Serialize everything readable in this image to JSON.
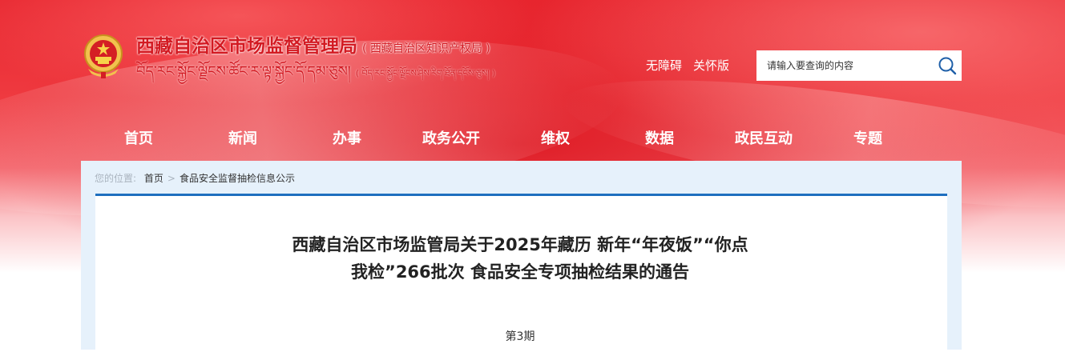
{
  "header": {
    "title_cn": "西藏自治区市场监督管理局",
    "title_cn_sub": "( 西藏自治区知识产权局 )",
    "title_tb": "བོད་རང་སྐྱོང་ལྗོངས་ཚོང་ར་ལྟ་སྐྱོང་དོ་དམ་ཅུས།",
    "title_tb_sub": "( བོད་རང་སྐྱོང་ལྗོངས་ཤེས་རིག་ཐོན་དངོས་ཅུས། )",
    "accessibility_link": "无障碍",
    "elder_link": "关怀版",
    "search_placeholder": "请输入要查询的内容"
  },
  "nav": {
    "items": [
      "首页",
      "新闻",
      "办事",
      "政务公开",
      "维权",
      "数据",
      "政民互动",
      "专题"
    ]
  },
  "breadcrumb": {
    "label": "您的位置:",
    "home": "首页",
    "separator": ">",
    "current": "食品安全监督抽检信息公示"
  },
  "article": {
    "title": "西藏自治区市场监管局关于2025年藏历 新年“年夜饭”“你点我检”266批次 食品安全专项抽检结果的通告",
    "issue": "第3期"
  },
  "colors": {
    "brand_red": "#d31a22",
    "nav_text": "#ffffff",
    "accent_blue": "#1e6fbf",
    "frame_bg": "#e6f1fb"
  },
  "icons": {
    "emblem": "national-emblem-icon",
    "search": "search-icon"
  }
}
